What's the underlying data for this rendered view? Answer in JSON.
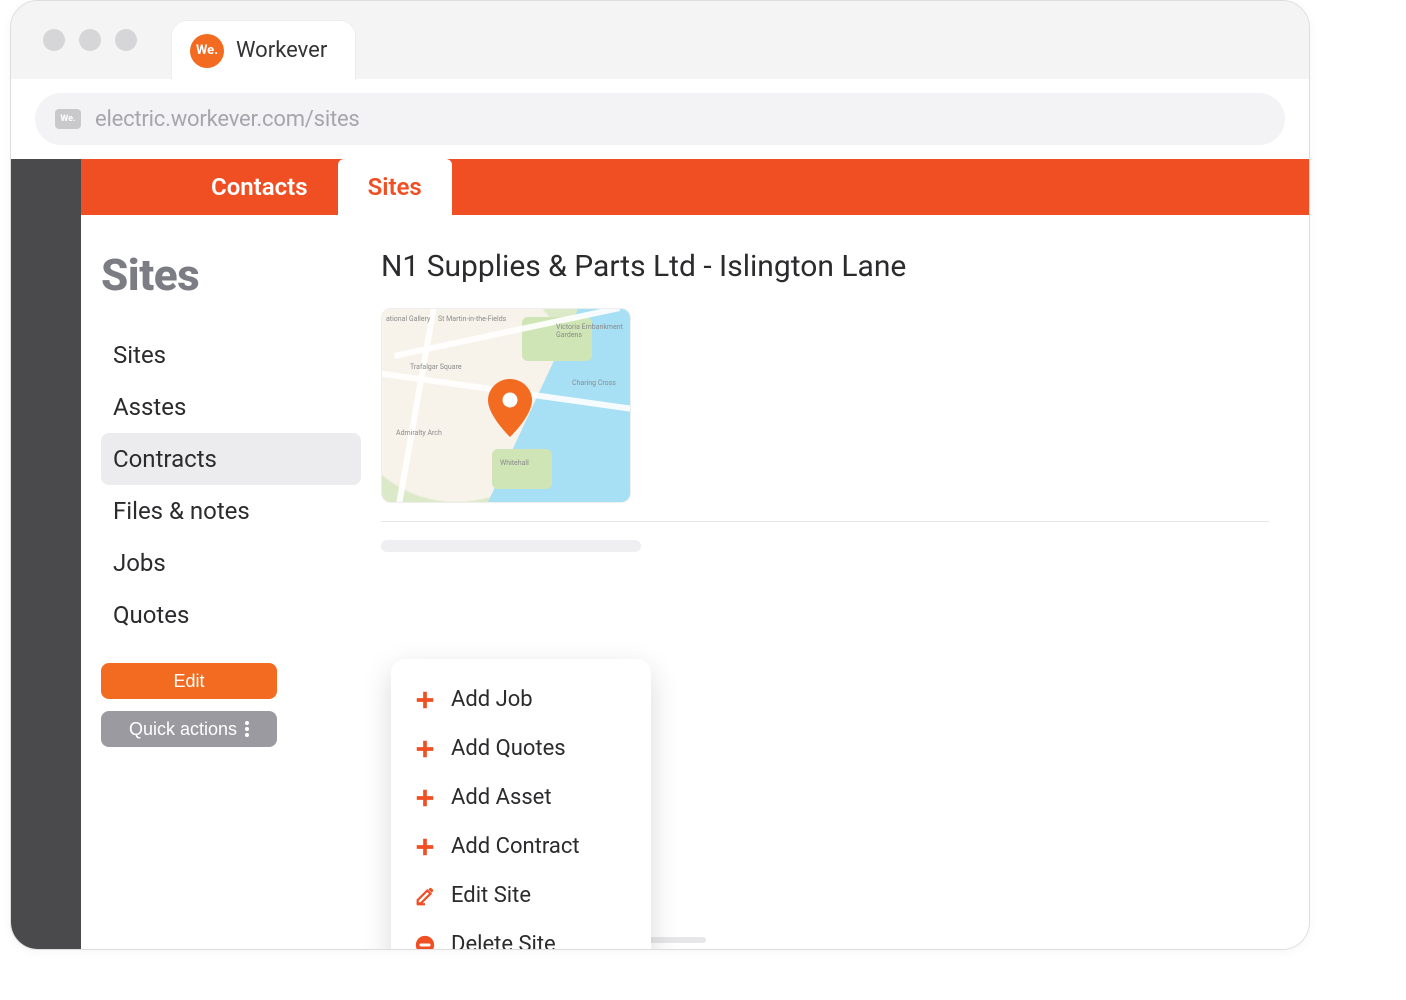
{
  "browser": {
    "tab_title": "Workever",
    "logo_text": "We.",
    "url": "electric.workever.com/sites",
    "url_chip": "We."
  },
  "ribbon": {
    "tabs": [
      {
        "label": "Contacts",
        "active": false
      },
      {
        "label": "Sites",
        "active": true
      }
    ]
  },
  "sidebar": {
    "heading": "Sites",
    "items": [
      {
        "label": "Sites"
      },
      {
        "label": "Asstes"
      },
      {
        "label": "Contracts"
      },
      {
        "label": "Files & notes"
      },
      {
        "label": "Jobs"
      },
      {
        "label": "Quotes"
      }
    ],
    "selected_index": 2,
    "edit_label": "Edit",
    "quick_actions_label": "Quick actions"
  },
  "page": {
    "title": "N1 Supplies & Parts Ltd - Islington Lane"
  },
  "map": {
    "labels": [
      "Trafalgar Square",
      "St Martin-in-the-Fields",
      "Victoria Embankment Gardens",
      "Charing Cross",
      "Admiralty Arch",
      "Whitehall",
      "ational Gallery"
    ]
  },
  "quick_actions_menu": [
    {
      "icon": "plus-icon",
      "label": "Add Job"
    },
    {
      "icon": "plus-icon",
      "label": "Add Quotes"
    },
    {
      "icon": "plus-icon",
      "label": "Add Asset"
    },
    {
      "icon": "plus-icon",
      "label": "Add Contract"
    },
    {
      "icon": "edit-icon",
      "label": "Edit Site"
    },
    {
      "icon": "delete-icon",
      "label": "Delete Site"
    }
  ],
  "colors": {
    "accent": "#f04e23",
    "accent_alt": "#f26b21",
    "muted": "#9a9aa0"
  }
}
